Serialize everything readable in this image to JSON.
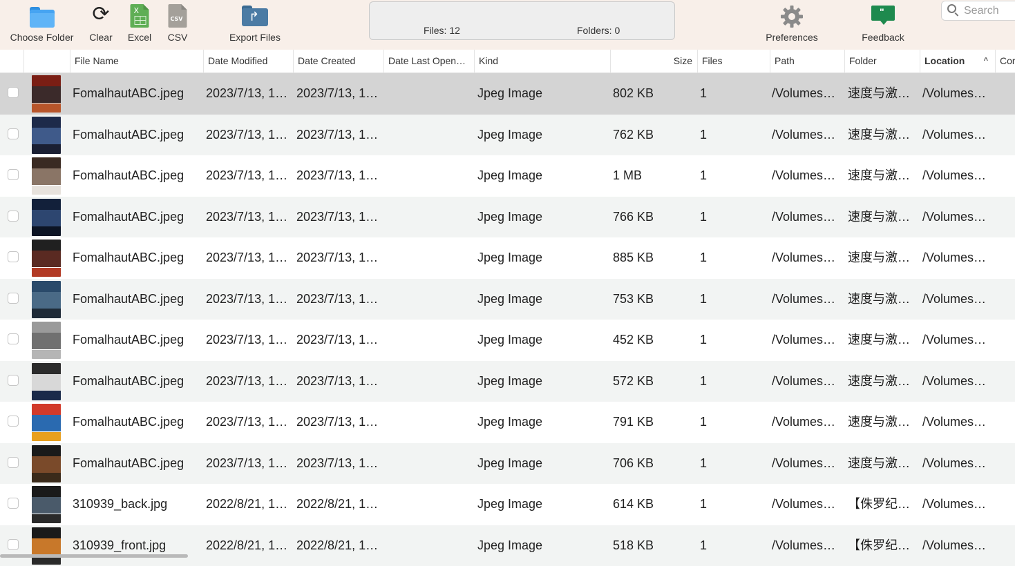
{
  "toolbar": {
    "choose_folder": "Choose Folder",
    "clear": "Clear",
    "excel": "Excel",
    "excel_icon_letter": "X",
    "csv": "CSV",
    "csv_icon_text": "CSV",
    "export_files": "Export Files",
    "preferences": "Preferences",
    "feedback": "Feedback",
    "feedback_icon_text": "\""
  },
  "status": {
    "files": "Files: 12",
    "folders": "Folders: 0"
  },
  "search": {
    "placeholder": "Search"
  },
  "columns": [
    "File Name",
    "Date Modified",
    "Date Created",
    "Date Last Open…",
    "Kind",
    "Size",
    "Files",
    "Path",
    "Folder",
    "Location",
    "Cor"
  ],
  "sort_indicator": "^",
  "rows": [
    {
      "name": "FomalhautABC.jpeg",
      "modified": "2023/7/13, 1…",
      "created": "2023/7/13, 1…",
      "kind": "Jpeg Image",
      "size": "802 KB",
      "files": "1",
      "path": "/Volumes…",
      "folder": "速度与激…",
      "location": "/Volumes…",
      "thumb": [
        "#7a1e14",
        "#3b2a2a",
        "#b8552a"
      ]
    },
    {
      "name": "FomalhautABC.jpeg",
      "modified": "2023/7/13, 1…",
      "created": "2023/7/13, 1…",
      "kind": "Jpeg Image",
      "size": "762 KB",
      "files": "1",
      "path": "/Volumes…",
      "folder": "速度与激…",
      "location": "/Volumes…",
      "thumb": [
        "#1d2a4a",
        "#3f5a8a",
        "#1a1f33"
      ]
    },
    {
      "name": "FomalhautABC.jpeg",
      "modified": "2023/7/13, 1…",
      "created": "2023/7/13, 1…",
      "kind": "Jpeg Image",
      "size": "1 MB",
      "files": "1",
      "path": "/Volumes…",
      "folder": "速度与激…",
      "location": "/Volumes…",
      "thumb": [
        "#3a2a22",
        "#8a7566",
        "#e7e2dc"
      ]
    },
    {
      "name": "FomalhautABC.jpeg",
      "modified": "2023/7/13, 1…",
      "created": "2023/7/13, 1…",
      "kind": "Jpeg Image",
      "size": "766 KB",
      "files": "1",
      "path": "/Volumes…",
      "folder": "速度与激…",
      "location": "/Volumes…",
      "thumb": [
        "#12203a",
        "#2d4670",
        "#0c1424"
      ]
    },
    {
      "name": "FomalhautABC.jpeg",
      "modified": "2023/7/13, 1…",
      "created": "2023/7/13, 1…",
      "kind": "Jpeg Image",
      "size": "885 KB",
      "files": "1",
      "path": "/Volumes…",
      "folder": "速度与激…",
      "location": "/Volumes…",
      "thumb": [
        "#202020",
        "#5a2a22",
        "#b23a24"
      ]
    },
    {
      "name": "FomalhautABC.jpeg",
      "modified": "2023/7/13, 1…",
      "created": "2023/7/13, 1…",
      "kind": "Jpeg Image",
      "size": "753 KB",
      "files": "1",
      "path": "/Volumes…",
      "folder": "速度与激…",
      "location": "/Volumes…",
      "thumb": [
        "#2a4a6a",
        "#4a6a86",
        "#1e2a36"
      ]
    },
    {
      "name": "FomalhautABC.jpeg",
      "modified": "2023/7/13, 1…",
      "created": "2023/7/13, 1…",
      "kind": "Jpeg Image",
      "size": "452 KB",
      "files": "1",
      "path": "/Volumes…",
      "folder": "速度与激…",
      "location": "/Volumes…",
      "thumb": [
        "#9a9a9a",
        "#707070",
        "#b5b5b5"
      ]
    },
    {
      "name": "FomalhautABC.jpeg",
      "modified": "2023/7/13, 1…",
      "created": "2023/7/13, 1…",
      "kind": "Jpeg Image",
      "size": "572 KB",
      "files": "1",
      "path": "/Volumes…",
      "folder": "速度与激…",
      "location": "/Volumes…",
      "thumb": [
        "#2b2b2b",
        "#d8d8d8",
        "#1a2a4a"
      ]
    },
    {
      "name": "FomalhautABC.jpeg",
      "modified": "2023/7/13, 1…",
      "created": "2023/7/13, 1…",
      "kind": "Jpeg Image",
      "size": "791 KB",
      "files": "1",
      "path": "/Volumes…",
      "folder": "速度与激…",
      "location": "/Volumes…",
      "thumb": [
        "#d23a2a",
        "#2a6ab0",
        "#e8a020"
      ]
    },
    {
      "name": "FomalhautABC.jpeg",
      "modified": "2023/7/13, 1…",
      "created": "2023/7/13, 1…",
      "kind": "Jpeg Image",
      "size": "706 KB",
      "files": "1",
      "path": "/Volumes…",
      "folder": "速度与激…",
      "location": "/Volumes…",
      "thumb": [
        "#1a1a1a",
        "#7a4a2a",
        "#3a2a1a"
      ]
    },
    {
      "name": "310939_back.jpg",
      "modified": "2022/8/21, 1…",
      "created": "2022/8/21, 1…",
      "kind": "Jpeg Image",
      "size": "614 KB",
      "files": "1",
      "path": "/Volumes…",
      "folder": "【侏罗纪…",
      "location": "/Volumes…",
      "thumb": [
        "#1a1a1a",
        "#4a5a6a",
        "#2a2a2a"
      ]
    },
    {
      "name": "310939_front.jpg",
      "modified": "2022/8/21, 1…",
      "created": "2022/8/21, 1…",
      "kind": "Jpeg Image",
      "size": "518 KB",
      "files": "1",
      "path": "/Volumes…",
      "folder": "【侏罗纪…",
      "location": "/Volumes…",
      "thumb": [
        "#1a1a1a",
        "#c8782a",
        "#2a2a2a"
      ]
    }
  ],
  "colors": {
    "toolbar_bg": "#f8efe9",
    "row_alt": "#f2f4f3",
    "row_selected": "#d4d4d4"
  }
}
